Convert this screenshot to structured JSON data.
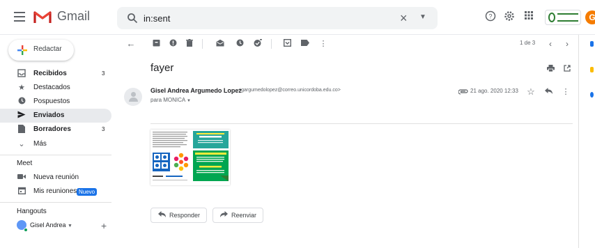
{
  "app": {
    "name": "Gmail",
    "search_query": "in:sent"
  },
  "compose": {
    "label": "Redactar"
  },
  "sidebar": {
    "items": [
      {
        "label": "Recibidos",
        "count": "3",
        "icon": "inbox-icon"
      },
      {
        "label": "Destacados",
        "count": "",
        "icon": "star-icon"
      },
      {
        "label": "Pospuestos",
        "count": "",
        "icon": "clock-icon"
      },
      {
        "label": "Enviados",
        "count": "",
        "icon": "send-icon"
      },
      {
        "label": "Borradores",
        "count": "3",
        "icon": "draft-icon"
      },
      {
        "label": "Más",
        "count": "",
        "icon": "chevron-down-icon"
      }
    ],
    "meet_title": "Meet",
    "meet_items": [
      {
        "label": "Nueva reunión"
      },
      {
        "label": "Mis reuniones"
      }
    ],
    "new_badge": "Nuevo",
    "hangouts_title": "Hangouts",
    "hangouts_user": "Gisel Andrea"
  },
  "pager": {
    "text": "1 de 3"
  },
  "message": {
    "subject": "fayer",
    "sender_name": "Gisel Andrea Argumedo Lopez",
    "sender_email": "<gargumedolopez@correo.unicordoba.edu.co>",
    "to": "para MONICA",
    "date": "21 ago. 2020 12:33"
  },
  "actions": {
    "reply": "Responder",
    "forward": "Reenviar"
  },
  "colors": {
    "accent": "#1a73e8",
    "gmail_red": "#ea4335",
    "active_nav_bg": "#e8eaed",
    "flyer_green": "#00a651",
    "flyer_teal": "#26a69a",
    "flyer_blue": "#1565c0"
  }
}
